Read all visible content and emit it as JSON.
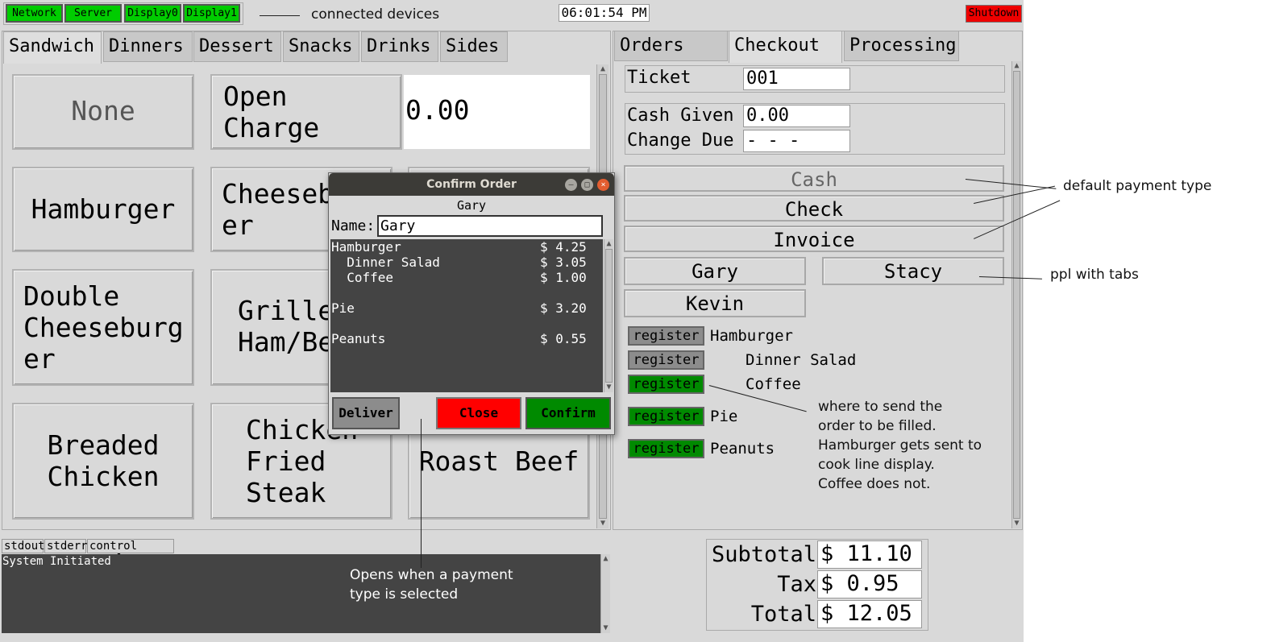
{
  "top_bar": {
    "devices": [
      "Network",
      "Server",
      "Display0",
      "Display1"
    ],
    "clock": "06:01:54 PM",
    "shutdown_label": "Shutdown"
  },
  "menu": {
    "tabs": [
      "Sandwich",
      "Dinners",
      "Dessert",
      "Snacks",
      "Drinks",
      "Sides"
    ],
    "active_tab": "Sandwich",
    "buttons": [
      "None",
      "Open\nCharge",
      "Hamburger",
      "Cheeseb\ner",
      "Double\nCheeseburg\ner",
      "Grille\nHam/Be",
      "Breaded\nChicken",
      "Chicken\nFried\nSteak",
      "Roast Beef"
    ],
    "open_charge_value": "0.00"
  },
  "console": {
    "tabs": [
      "stdout",
      "stderr",
      "control panel"
    ],
    "text": "System Initiated"
  },
  "right_panel": {
    "tabs": [
      "Orders",
      "Checkout",
      "Processing"
    ],
    "active_tab": "Checkout",
    "ticket_label": "Ticket",
    "ticket_value": "001",
    "cash_given_label": "Cash Given",
    "cash_given_value": "0.00",
    "change_due_label": "Change Due",
    "change_due_value": "- - -",
    "payment_types": [
      "Cash",
      "Check",
      "Invoice"
    ],
    "tab_people": [
      "Gary",
      "Stacy",
      "Kevin"
    ],
    "register_label": "register",
    "register_items": [
      {
        "name": "Hamburger",
        "indent": false,
        "state": "gray"
      },
      {
        "name": "Dinner Salad",
        "indent": true,
        "state": "gray"
      },
      {
        "name": "Coffee",
        "indent": true,
        "state": "green"
      },
      {
        "name": "Pie",
        "indent": false,
        "state": "green"
      },
      {
        "name": "Peanuts",
        "indent": false,
        "state": "green"
      }
    ]
  },
  "totals": {
    "subtotal_label": "Subtotal",
    "subtotal_value": "$ 11.10",
    "tax_label": "Tax",
    "tax_value": "$ 0.95",
    "total_label": "Total",
    "total_value": "$ 12.05"
  },
  "dialog": {
    "title": "Confirm Order",
    "customer": "Gary",
    "name_label": "Name:",
    "name_value": "Gary",
    "items": [
      {
        "name": "Hamburger",
        "price": "$ 4.25"
      },
      {
        "name": "  Dinner Salad",
        "price": "$ 3.05"
      },
      {
        "name": "  Coffee",
        "price": "$ 1.00"
      },
      {
        "name": "Pie",
        "price": "$ 3.20"
      },
      {
        "name": "Peanuts",
        "price": "$ 0.55"
      }
    ],
    "deliver_label": "Deliver",
    "close_label": "Close",
    "confirm_label": "Confirm"
  },
  "annotations": {
    "devices": "connected devices",
    "payment": "default payment type",
    "tabs": "ppl with tabs",
    "register": "where to send the\norder to be filled.\nHamburger gets sent to\ncook line display.\nCoffee does not.",
    "dialog": "Opens when a payment\ntype is selected"
  },
  "colors": {
    "device_ok": "#00cc00",
    "shutdown": "#ee0000",
    "register_active": "#008a00",
    "register_inactive": "#8c8c8c",
    "close_button": "#ff0000",
    "confirm_button": "#008a00"
  }
}
